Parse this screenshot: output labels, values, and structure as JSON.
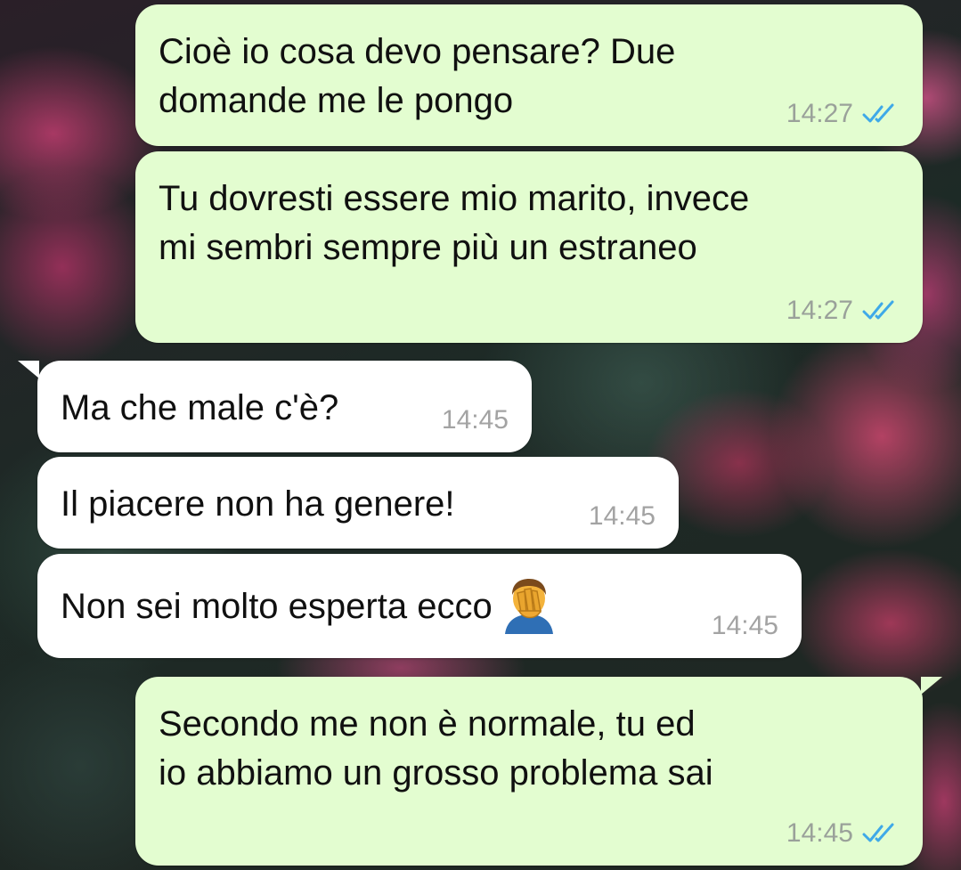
{
  "chat": {
    "messages": [
      {
        "direction": "outgoing",
        "text": "Cioè io cosa devo pensare? Due\ndomande me le pongo",
        "time": "14:27",
        "status": "read"
      },
      {
        "direction": "outgoing",
        "text": "Tu dovresti essere mio marito, invece\nmi sembri sempre più un estraneo",
        "time": "14:27",
        "status": "read"
      },
      {
        "direction": "incoming",
        "text": "Ma che male c'è?",
        "time": "14:45"
      },
      {
        "direction": "incoming",
        "text": "Il piacere non ha genere!",
        "time": "14:45"
      },
      {
        "direction": "incoming",
        "text": "Non sei molto esperta ecco",
        "emoji": "man-facepalming-emoji",
        "time": "14:45"
      },
      {
        "direction": "outgoing",
        "text": "Secondo me non è normale, tu ed\nio abbiamo un grosso problema sai",
        "time": "14:45",
        "status": "read"
      }
    ]
  },
  "colors": {
    "outgoing_bubble": "#e3fdd0",
    "incoming_bubble": "#ffffff",
    "read_ticks": "#3fa9e8",
    "timestamp": "#9aa19a"
  },
  "icons": {
    "read_receipt": "double-check-icon",
    "wallpaper": "pink-flowers-wallpaper"
  }
}
